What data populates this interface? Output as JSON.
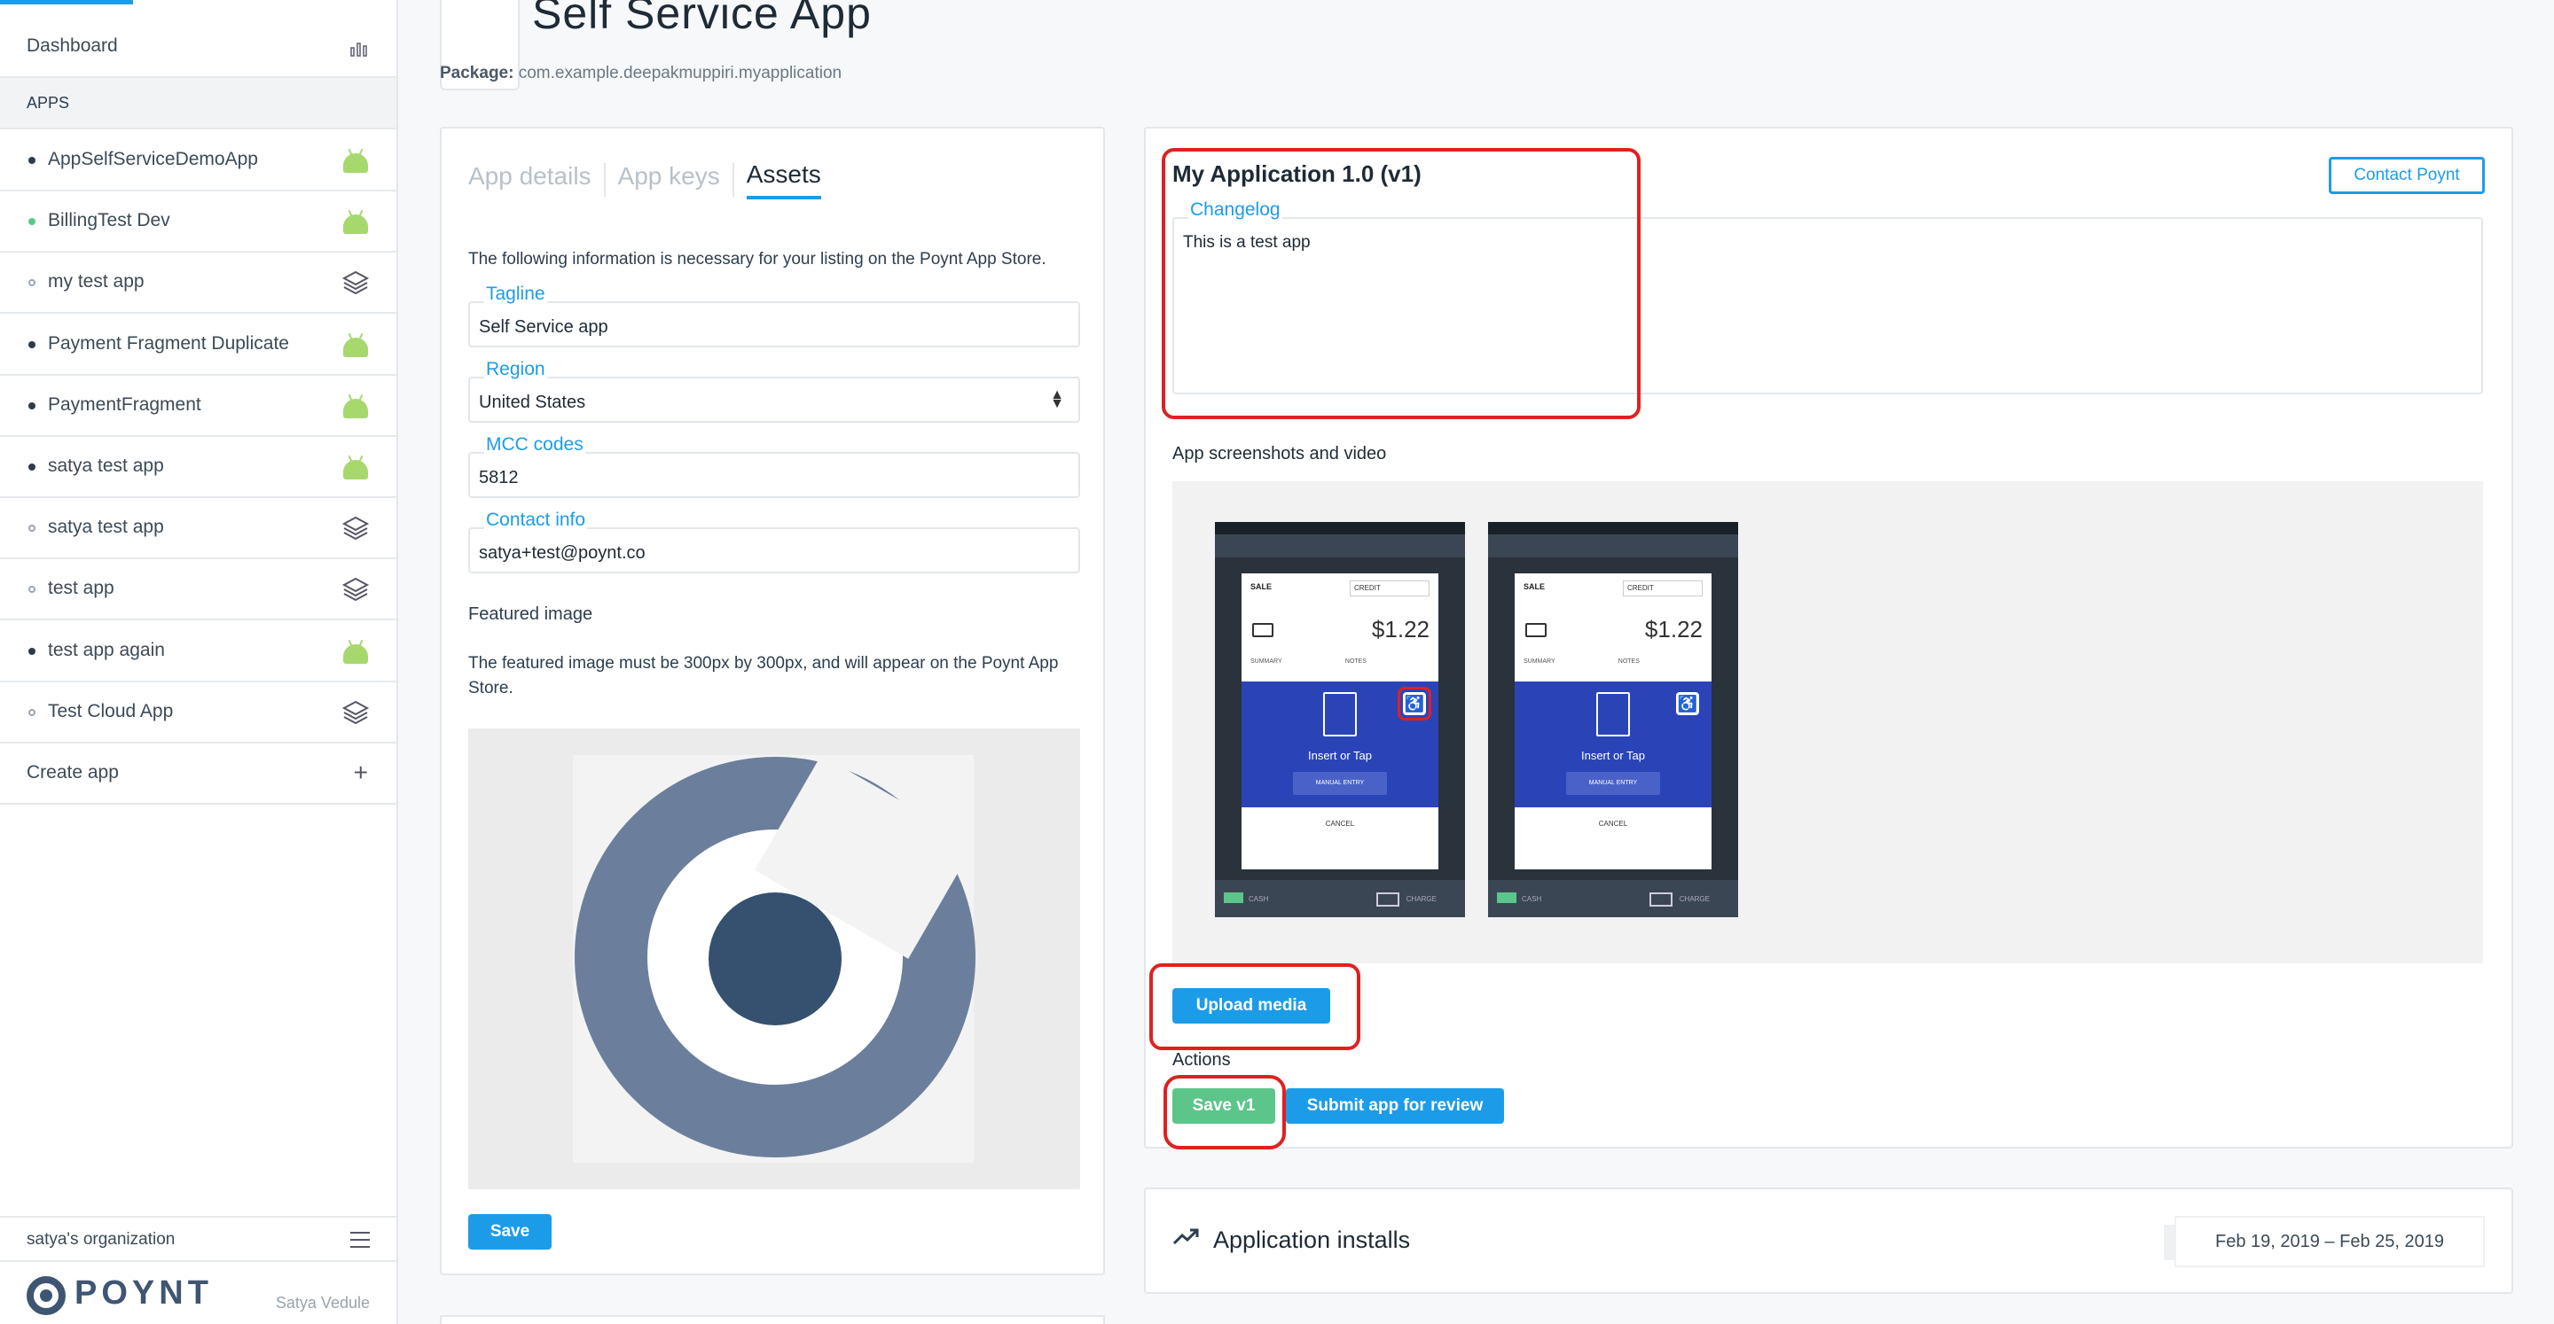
{
  "sidebar": {
    "dashboard_label": "Dashboard",
    "apps_header": "APPS",
    "apps": [
      {
        "label": "AppSelfServiceDemoApp",
        "dot": "solid",
        "icon": "android-icon"
      },
      {
        "label": "BillingTest Dev",
        "dot": "green",
        "icon": "android-icon"
      },
      {
        "label": "my test app",
        "dot": "hollow",
        "icon": "layers-icon"
      },
      {
        "label": "Payment Fragment Duplicate",
        "dot": "solid",
        "icon": "android-icon"
      },
      {
        "label": "PaymentFragment",
        "dot": "solid",
        "icon": "android-icon"
      },
      {
        "label": "satya test app",
        "dot": "solid",
        "icon": "android-icon"
      },
      {
        "label": "satya test app",
        "dot": "hollow",
        "icon": "layers-icon"
      },
      {
        "label": "test app",
        "dot": "hollow",
        "icon": "layers-icon"
      },
      {
        "label": "test app again",
        "dot": "solid",
        "icon": "android-icon"
      },
      {
        "label": "Test Cloud App",
        "dot": "hollow",
        "icon": "layers-icon"
      }
    ],
    "create_app_label": "Create app",
    "organization": "satya's organization",
    "logo_text": "POYNT",
    "user_name": "Satya Vedule"
  },
  "header": {
    "title": "Self Service App",
    "package_label": "Package:",
    "package_value": "com.example.deepakmuppiri.myapplication"
  },
  "assets": {
    "tabs": [
      {
        "label": "App details",
        "active": false
      },
      {
        "label": "App keys",
        "active": false
      },
      {
        "label": "Assets",
        "active": true
      }
    ],
    "intro": "The following information is necessary for your listing on the Poynt App Store.",
    "tagline": {
      "label": "Tagline",
      "value": "Self Service app"
    },
    "region": {
      "label": "Region",
      "value": "United States"
    },
    "mcc": {
      "label": "MCC codes",
      "value": "5812"
    },
    "contact": {
      "label": "Contact info",
      "value": "satya+test@poynt.co"
    },
    "featured_title": "Featured image",
    "featured_note": "The featured image must be 300px by 300px, and will appear on the Poynt App Store.",
    "save_label": "Save"
  },
  "version": {
    "title": "My Application 1.0 (v1)",
    "contact_label": "Contact Poynt",
    "changelog_label": "Changelog",
    "changelog_value": "This is a test app",
    "screenshots_label": "App screenshots and video",
    "upload_label": "Upload media",
    "actions_label": "Actions",
    "save_label": "Save v1",
    "submit_label": "Submit app for review"
  },
  "screenshot_content": {
    "sale": "SALE",
    "credit": "CREDIT",
    "amount": "$1.22",
    "tab_summary": "SUMMARY",
    "tab_notes": "NOTES",
    "insert": "Insert or Tap",
    "manual": "MANUAL ENTRY",
    "cancel": "CANCEL",
    "cash": "CASH",
    "charge": "CHARGE"
  },
  "installs": {
    "title": "Application installs",
    "date_range": "Feb 19, 2019 – Feb 25, 2019"
  },
  "colors": {
    "accent": "#1c9ce8",
    "success": "#5cc58a",
    "highlight": "#e02020"
  }
}
